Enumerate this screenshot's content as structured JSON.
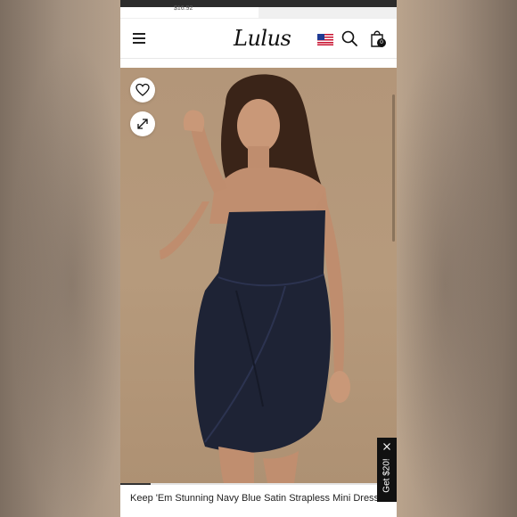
{
  "promo": {
    "text": "$16.92"
  },
  "header": {
    "logo_text": "Lulus",
    "cart_count": "0"
  },
  "gallery": {
    "progress_fraction": 0.11
  },
  "product": {
    "title": "Keep 'Em Stunning Navy Blue Satin Strapless Mini Dress"
  },
  "side_tab": {
    "label": "Get $20!"
  },
  "icons": {
    "menu": "hamburger-menu-icon",
    "flag": "us-flag-icon",
    "search": "search-icon",
    "bag": "shopping-bag-icon",
    "heart": "heart-icon",
    "expand": "expand-icon",
    "close": "close-icon"
  },
  "colors": {
    "photo_background": "#b39679",
    "dress_color": "#1e2335",
    "accent_dark": "#111111"
  }
}
